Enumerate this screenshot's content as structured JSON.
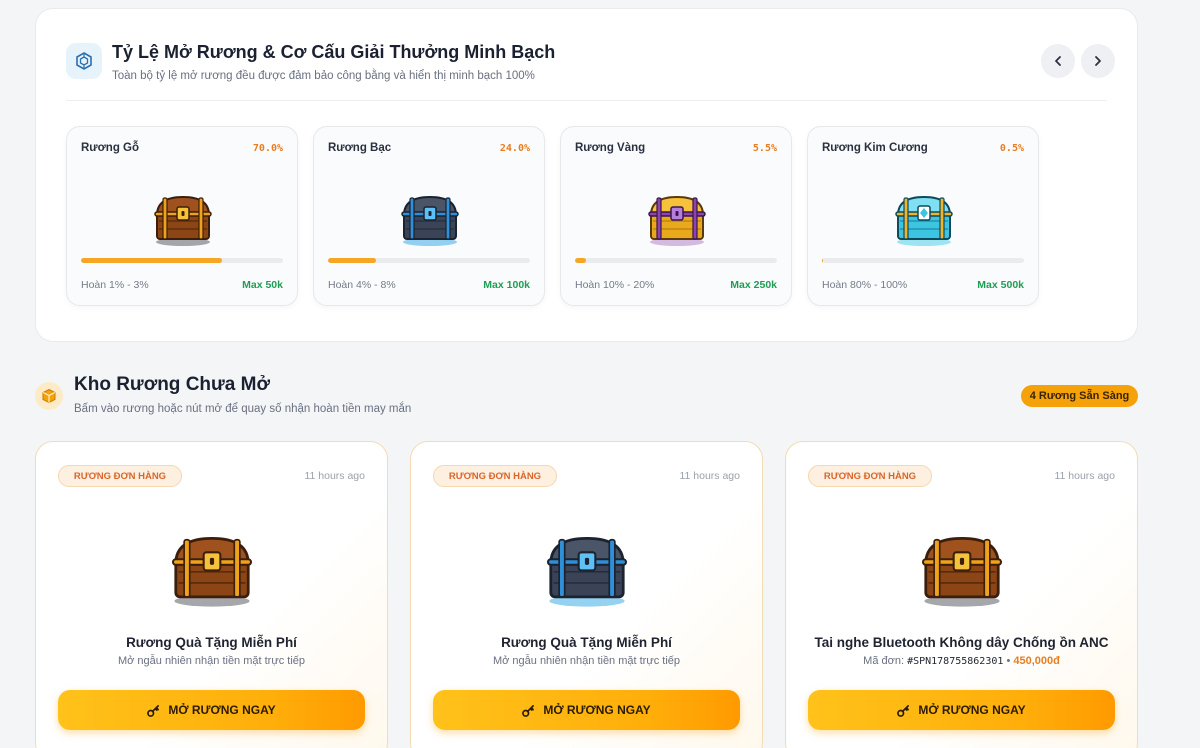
{
  "rates": {
    "title": "Tỷ Lệ Mở Rương & Cơ Cấu Giải Thưởng Minh Bạch",
    "subtitle": "Toàn bộ tỷ lệ mở rương đều được đảm bảo công bằng và hiển thị minh bạch 100%",
    "tiers": [
      {
        "name": "Rương Gỗ",
        "percent": "70.0%",
        "fill": 0.7,
        "range": "Hoàn 1% - 3%",
        "max": "Max 50k",
        "chest": "wood-chest"
      },
      {
        "name": "Rương Bạc",
        "percent": "24.0%",
        "fill": 0.24,
        "range": "Hoàn 4% - 8%",
        "max": "Max 100k",
        "chest": "silver-chest"
      },
      {
        "name": "Rương Vàng",
        "percent": "5.5%",
        "fill": 0.055,
        "range": "Hoàn 10% - 20%",
        "max": "Max 250k",
        "chest": "gold-chest"
      },
      {
        "name": "Rương Kim Cương",
        "percent": "0.5%",
        "fill": 0.005,
        "range": "Hoàn 80% - 100%",
        "max": "Max 500k",
        "chest": "diamond-chest"
      }
    ]
  },
  "inventory": {
    "title": "Kho Rương Chưa Mở",
    "subtitle": "Bấm vào rương hoặc nút mở để quay số nhận hoàn tiền may mắn",
    "ready_badge": "4 Rương Sẵn Sàng",
    "cards": [
      {
        "tag": "RƯƠNG ĐƠN HÀNG",
        "time": "11 hours ago",
        "title": "Rương Quà Tặng Miễn Phí",
        "desc": "Mở ngẫu nhiên nhận tiền mặt trực tiếp",
        "button": "MỞ RƯƠNG NGAY",
        "chest": "wood-chest"
      },
      {
        "tag": "RƯƠNG ĐƠN HÀNG",
        "time": "11 hours ago",
        "title": "Rương Quà Tặng Miễn Phí",
        "desc": "Mở ngẫu nhiên nhận tiền mặt trực tiếp",
        "button": "MỞ RƯƠNG NGAY",
        "chest": "silver-chest"
      },
      {
        "tag": "RƯƠNG ĐƠN HÀNG",
        "time": "11 hours ago",
        "title": "Tai nghe Bluetooth Không dây Chống ồn ANC",
        "desc_prefix": "Mã đơn: ",
        "order_code": "#SPN178755862301",
        "separator": " • ",
        "price": "450,000đ",
        "button": "MỞ RƯƠNG NGAY",
        "chest": "wood-chest"
      }
    ]
  },
  "icons": {
    "header_icon": "hexagon-crypto-icon",
    "section_icon": "box-icon",
    "button_icon": "key-icon",
    "nav_prev": "chevron-left-icon",
    "nav_next": "chevron-right-icon"
  },
  "colors": {
    "accent": "#f5a623",
    "percent": "#e67e22",
    "max": "#1f9d55",
    "button": "#ffb000"
  }
}
